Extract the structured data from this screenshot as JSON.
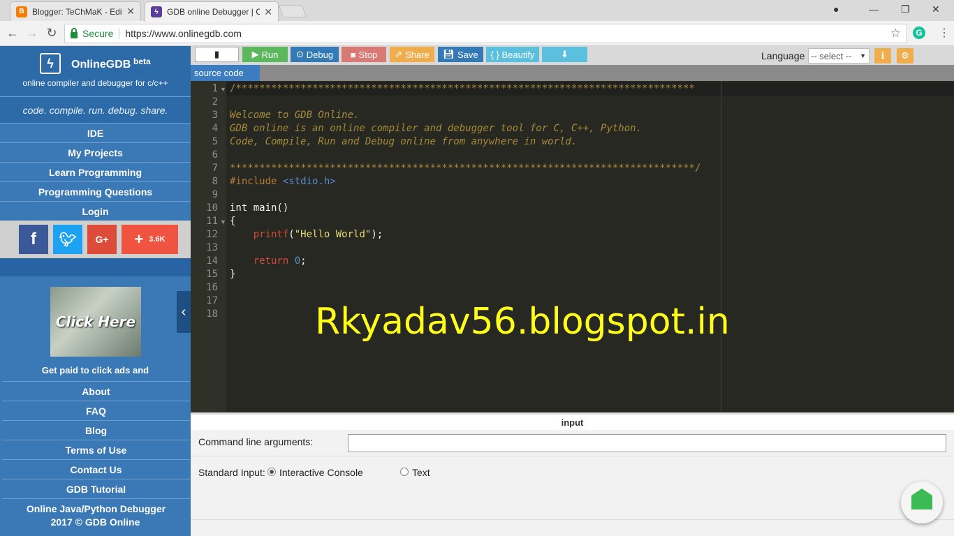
{
  "browser": {
    "tabs": [
      {
        "label": "Blogger: TeChMaK - Edit",
        "favicon": "blogger-icon",
        "color": "#f57d00"
      },
      {
        "label": "GDB online Debugger | C",
        "favicon": "bolt-icon",
        "color": "#5a3e99"
      }
    ],
    "address": {
      "secure_label": "Secure",
      "url": "https://www.onlinegdb.com"
    }
  },
  "sidebar": {
    "brand": {
      "name": "OnlineGDB",
      "beta": "beta",
      "subtitle": "online compiler and debugger for c/c++"
    },
    "tagline": "code. compile. run. debug. share.",
    "nav": [
      "IDE",
      "My Projects",
      "Learn Programming",
      "Programming Questions",
      "Login"
    ],
    "social": {
      "share_count": "3.6K"
    },
    "ad": {
      "image_text": "Click Here",
      "caption": "Get paid to click ads and"
    },
    "nav_bottom": [
      "About",
      "FAQ",
      "Blog",
      "Terms of Use",
      "Contact Us",
      "GDB Tutorial",
      "Online Java/Python Debugger"
    ],
    "footer": "2017 © GDB Online"
  },
  "toolbar": {
    "run": "Run",
    "debug": "Debug",
    "stop": "Stop",
    "share": "Share",
    "save": "Save",
    "beautify": "{ } Beautify",
    "language_label": "Language",
    "language_value": "-- select --"
  },
  "editor": {
    "tab_label": "source code",
    "line_numbers": [
      "1",
      "2",
      "3",
      "4",
      "5",
      "6",
      "7",
      "8",
      "9",
      "10",
      "11",
      "12",
      "13",
      "14",
      "15",
      "16",
      "17",
      "18"
    ],
    "lines": {
      "l1": "/******************************************************************************",
      "l3": "Welcome to GDB Online.",
      "l4": "GDB online is an online compiler and debugger tool for C, C++, Python.",
      "l5": "Code, Compile, Run and Debug online from anywhere in world.",
      "l7": "*******************************************************************************/",
      "l8_kw": "#include",
      "l8_hdr": "<stdio.h>",
      "l10": "int main()",
      "l11": "{",
      "l12_fn": "printf",
      "l12_open": "(",
      "l12_str": "\"Hello World\"",
      "l12_close": ");",
      "l14_kw": "return",
      "l14_num": "0",
      "l14_end": ";",
      "l15": "}"
    },
    "watermark": "Rkyadav56.blogspot.in"
  },
  "input_panel": {
    "header": "input",
    "cmd_label": "Command line arguments:",
    "stdin_label": "Standard Input:",
    "options": [
      "Interactive Console",
      "Text"
    ],
    "selected": "Interactive Console"
  }
}
